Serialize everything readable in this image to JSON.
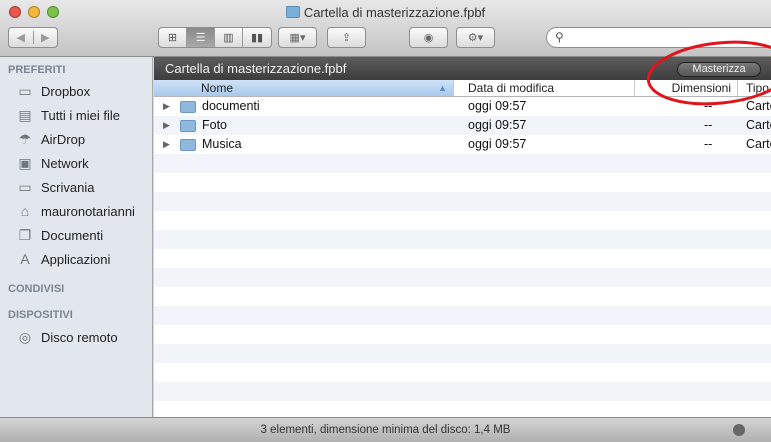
{
  "window": {
    "title": "Cartella di masterizzazione.fpbf"
  },
  "toolbar": {
    "back": "◀",
    "forward": "▶",
    "views": [
      "icon-view",
      "list-view",
      "column-view",
      "coverflow-view"
    ],
    "arrange": "▾",
    "share": "⇪",
    "quicklook": "◉",
    "action": "⚙▾",
    "search_icon": "⚲",
    "search_value": ""
  },
  "sidebar": {
    "sections": [
      {
        "title": "PREFERITI",
        "items": [
          {
            "label": "Dropbox",
            "icon": "folder"
          },
          {
            "label": "Tutti i miei file",
            "icon": "all-files"
          },
          {
            "label": "AirDrop",
            "icon": "airdrop"
          },
          {
            "label": "Network",
            "icon": "network"
          },
          {
            "label": "Scrivania",
            "icon": "desktop"
          },
          {
            "label": "mauronotarianni",
            "icon": "home"
          },
          {
            "label": "Documenti",
            "icon": "documents"
          },
          {
            "label": "Applicazioni",
            "icon": "applications"
          }
        ]
      },
      {
        "title": "CONDIVISI",
        "items": []
      },
      {
        "title": "DISPOSITIVI",
        "items": [
          {
            "label": "Disco remoto",
            "icon": "disc"
          }
        ]
      }
    ]
  },
  "path_bar": {
    "title": "Cartella di masterizzazione.fpbf",
    "burn_button": "Masterizza"
  },
  "columns": {
    "name": "Nome",
    "date": "Data di modifica",
    "size": "Dimensioni",
    "kind": "Tipo"
  },
  "files": [
    {
      "name": "documenti",
      "date": "oggi 09:57",
      "size": "--",
      "kind": "Cartella"
    },
    {
      "name": "Foto",
      "date": "oggi 09:57",
      "size": "--",
      "kind": "Cartella"
    },
    {
      "name": "Musica",
      "date": "oggi 09:57",
      "size": "--",
      "kind": "Cartella"
    }
  ],
  "status": {
    "text": "3 elementi, dimensione minima del disco: 1,4 MB"
  },
  "colors": {
    "annotation": "#e0141c",
    "selected_header": "#a8c9ec"
  }
}
